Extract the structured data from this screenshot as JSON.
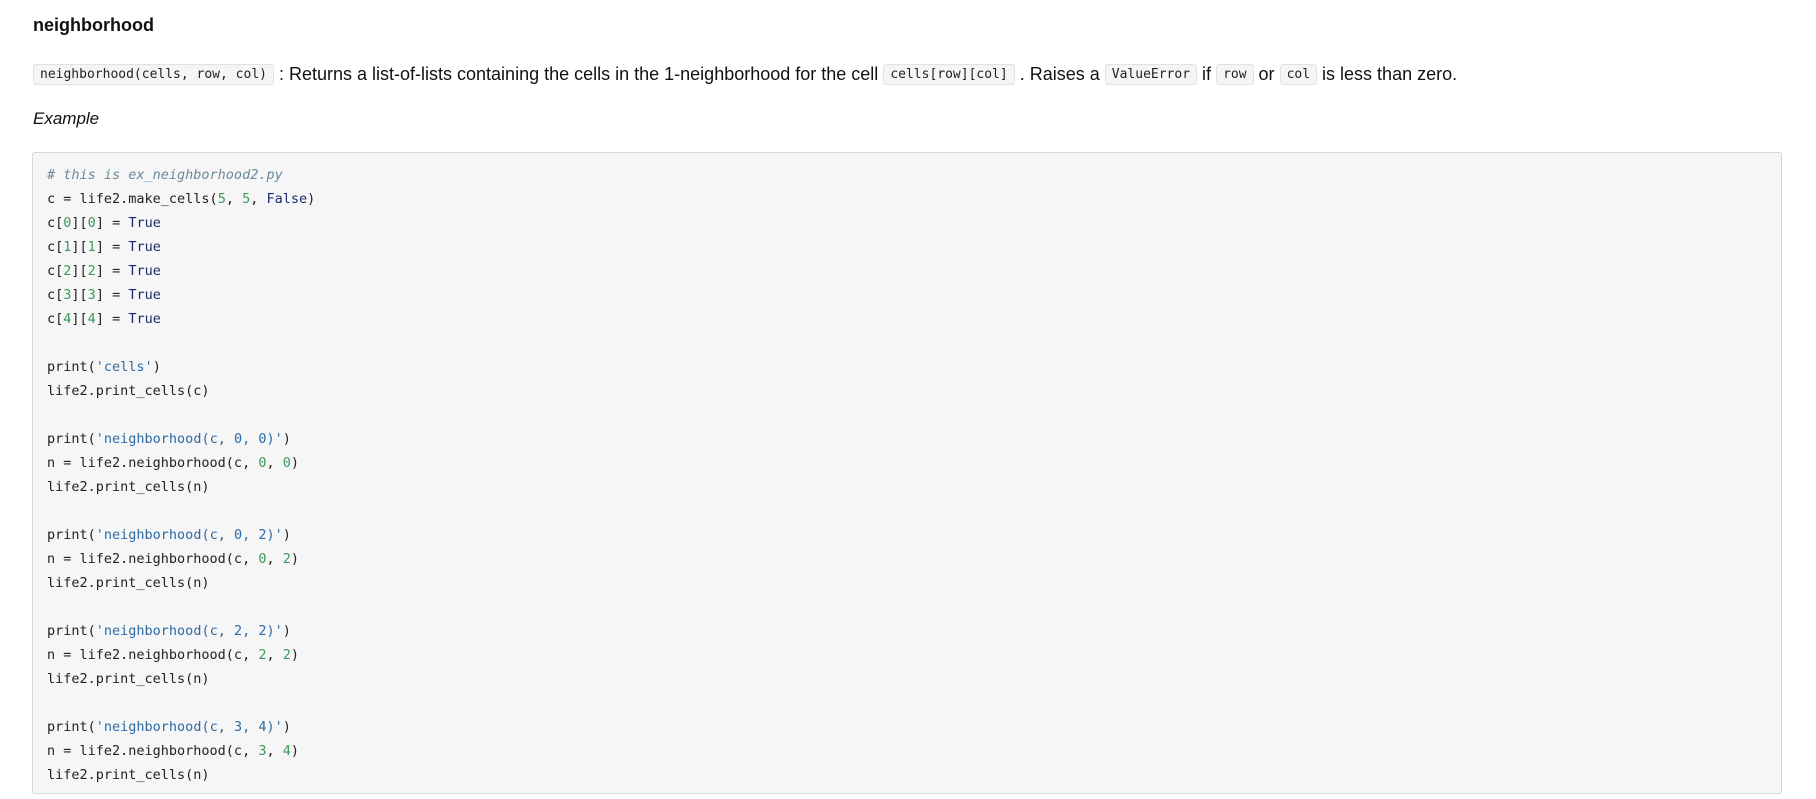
{
  "doc": {
    "title": "neighborhood",
    "description": [
      {
        "type": "code",
        "text": "neighborhood(cells, row, col)"
      },
      {
        "type": "text",
        "text": " : Returns a list-of-lists containing the cells in the 1-neighborhood for the cell "
      },
      {
        "type": "code",
        "text": "cells[row][col]"
      },
      {
        "type": "text",
        "text": " . Raises a "
      },
      {
        "type": "code",
        "text": "ValueError"
      },
      {
        "type": "text",
        "text": " if "
      },
      {
        "type": "code",
        "text": "row"
      },
      {
        "type": "text",
        "text": " or "
      },
      {
        "type": "code",
        "text": "col"
      },
      {
        "type": "text",
        "text": " is less than zero."
      }
    ],
    "example_label": "Example"
  },
  "code": {
    "lines": [
      [
        [
          "comment",
          "# this is ex_neighborhood2.py"
        ]
      ],
      [
        [
          "plain",
          "c = life2.make_cells("
        ],
        [
          "num",
          "5"
        ],
        [
          "plain",
          ", "
        ],
        [
          "num",
          "5"
        ],
        [
          "plain",
          ", "
        ],
        [
          "kw",
          "False"
        ],
        [
          "plain",
          ")"
        ]
      ],
      [
        [
          "plain",
          "c["
        ],
        [
          "num",
          "0"
        ],
        [
          "plain",
          "]["
        ],
        [
          "num",
          "0"
        ],
        [
          "plain",
          "] = "
        ],
        [
          "kw",
          "True"
        ]
      ],
      [
        [
          "plain",
          "c["
        ],
        [
          "num",
          "1"
        ],
        [
          "plain",
          "]["
        ],
        [
          "num",
          "1"
        ],
        [
          "plain",
          "] = "
        ],
        [
          "kw",
          "True"
        ]
      ],
      [
        [
          "plain",
          "c["
        ],
        [
          "num",
          "2"
        ],
        [
          "plain",
          "]["
        ],
        [
          "num",
          "2"
        ],
        [
          "plain",
          "] = "
        ],
        [
          "kw",
          "True"
        ]
      ],
      [
        [
          "plain",
          "c["
        ],
        [
          "num",
          "3"
        ],
        [
          "plain",
          "]["
        ],
        [
          "num",
          "3"
        ],
        [
          "plain",
          "] = "
        ],
        [
          "kw",
          "True"
        ]
      ],
      [
        [
          "plain",
          "c["
        ],
        [
          "num",
          "4"
        ],
        [
          "plain",
          "]["
        ],
        [
          "num",
          "4"
        ],
        [
          "plain",
          "] = "
        ],
        [
          "kw",
          "True"
        ]
      ],
      [],
      [
        [
          "plain",
          "print("
        ],
        [
          "str",
          "'cells'"
        ],
        [
          "plain",
          ")"
        ]
      ],
      [
        [
          "plain",
          "life2.print_cells(c)"
        ]
      ],
      [],
      [
        [
          "plain",
          "print("
        ],
        [
          "str",
          "'neighborhood(c, 0, 0)'"
        ],
        [
          "plain",
          ")"
        ]
      ],
      [
        [
          "plain",
          "n = life2.neighborhood(c, "
        ],
        [
          "num",
          "0"
        ],
        [
          "plain",
          ", "
        ],
        [
          "num",
          "0"
        ],
        [
          "plain",
          ")"
        ]
      ],
      [
        [
          "plain",
          "life2.print_cells(n)"
        ]
      ],
      [],
      [
        [
          "plain",
          "print("
        ],
        [
          "str",
          "'neighborhood(c, 0, 2)'"
        ],
        [
          "plain",
          ")"
        ]
      ],
      [
        [
          "plain",
          "n = life2.neighborhood(c, "
        ],
        [
          "num",
          "0"
        ],
        [
          "plain",
          ", "
        ],
        [
          "num",
          "2"
        ],
        [
          "plain",
          ")"
        ]
      ],
      [
        [
          "plain",
          "life2.print_cells(n)"
        ]
      ],
      [],
      [
        [
          "plain",
          "print("
        ],
        [
          "str",
          "'neighborhood(c, 2, 2)'"
        ],
        [
          "plain",
          ")"
        ]
      ],
      [
        [
          "plain",
          "n = life2.neighborhood(c, "
        ],
        [
          "num",
          "2"
        ],
        [
          "plain",
          ", "
        ],
        [
          "num",
          "2"
        ],
        [
          "plain",
          ")"
        ]
      ],
      [
        [
          "plain",
          "life2.print_cells(n)"
        ]
      ],
      [],
      [
        [
          "plain",
          "print("
        ],
        [
          "str",
          "'neighborhood(c, 3, 4)'"
        ],
        [
          "plain",
          ")"
        ]
      ],
      [
        [
          "plain",
          "n = life2.neighborhood(c, "
        ],
        [
          "num",
          "3"
        ],
        [
          "plain",
          ", "
        ],
        [
          "num",
          "4"
        ],
        [
          "plain",
          ")"
        ]
      ],
      [
        [
          "plain",
          "life2.print_cells(n)"
        ]
      ]
    ]
  }
}
